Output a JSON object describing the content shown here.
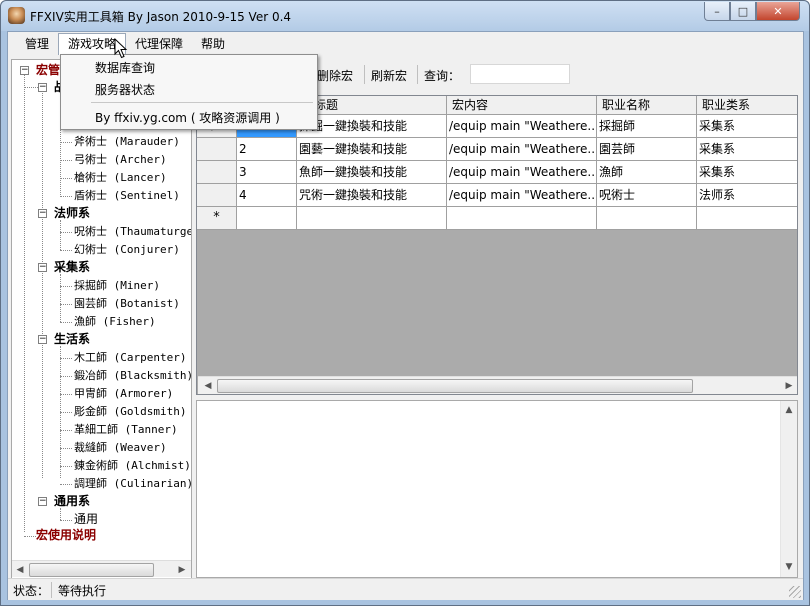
{
  "window": {
    "title": "FFXIV实用工具箱 By Jason 2010-9-15 Ver 0.4",
    "caption": {
      "minimize": "–",
      "maximize": "□",
      "close": "✕"
    }
  },
  "menubar": {
    "items": [
      {
        "label": "管理"
      },
      {
        "label": "游戏攻略"
      },
      {
        "label": "代理保障"
      },
      {
        "label": "帮助"
      }
    ],
    "open_menu": {
      "items": [
        "数据库查询",
        "服务器状态",
        "By ffxiv.yg.com ( 攻略资源调用 )"
      ]
    }
  },
  "tree": {
    "root_label": "宏管理",
    "visible": [
      {
        "label": "战",
        "kind": "category"
      },
      {
        "label": "斧術士 (Marauder)",
        "kind": "leaf"
      },
      {
        "label": "弓術士 (Archer)",
        "kind": "leaf"
      },
      {
        "label": "槍術士 (Lancer)",
        "kind": "leaf"
      },
      {
        "label": "盾術士 (Sentinel)",
        "kind": "leaf"
      },
      {
        "label": "法师系",
        "kind": "category"
      },
      {
        "label": "呪術士 (Thaumaturge)",
        "kind": "leaf"
      },
      {
        "label": "幻術士 (Conjurer)",
        "kind": "leaf"
      },
      {
        "label": "采集系",
        "kind": "category"
      },
      {
        "label": "採掘師 (Miner)",
        "kind": "leaf"
      },
      {
        "label": "園芸師 (Botanist)",
        "kind": "leaf"
      },
      {
        "label": "漁師 (Fisher)",
        "kind": "leaf"
      },
      {
        "label": "生活系",
        "kind": "category"
      },
      {
        "label": "木工師 (Carpenter)",
        "kind": "leaf"
      },
      {
        "label": "鍛冶師 (Blacksmith)",
        "kind": "leaf"
      },
      {
        "label": "甲冑師 (Armorer)",
        "kind": "leaf"
      },
      {
        "label": "彫金師 (Goldsmith)",
        "kind": "leaf"
      },
      {
        "label": "革細工師 (Tanner)",
        "kind": "leaf"
      },
      {
        "label": "裁縫師 (Weaver)",
        "kind": "leaf"
      },
      {
        "label": "錬金術師 (Alchmist)",
        "kind": "leaf"
      },
      {
        "label": "調理師 (Culinarian)",
        "kind": "leaf"
      },
      {
        "label": "通用系",
        "kind": "category"
      },
      {
        "label": "通用",
        "kind": "leaf"
      }
    ],
    "footer_label": "宏使用说明",
    "expander_minus": "−"
  },
  "toolbar": {
    "delete_macro": "删除宏",
    "refresh_macro": "刷新宏",
    "search_label": "查询：",
    "search_value": ""
  },
  "grid": {
    "columns": [
      "宏标题",
      "宏内容",
      "职业名称",
      "职业类系"
    ],
    "rows": [
      {
        "index": "1",
        "title": "採掘一鍵換裝和技能",
        "content": "/equip main \"Weathere...",
        "job": "採掘師",
        "class": "采集系",
        "selected_title": true
      },
      {
        "index": "2",
        "title": "園藝一鍵換裝和技能",
        "content": "/equip main \"Weathere...",
        "job": "園芸師",
        "class": "采集系"
      },
      {
        "index": "3",
        "title": "魚師一鍵換裝和技能",
        "content": "/equip main \"Weathere...",
        "job": "漁師",
        "class": "采集系"
      },
      {
        "index": "4",
        "title": "咒術一鍵換裝和技能",
        "content": "/equip main \"Weathere...",
        "job": "呪術士",
        "class": "法师系"
      }
    ],
    "new_row_marker": "*",
    "current_row_marker": "▶"
  },
  "status": {
    "label": "状态：",
    "value": "等待执行"
  },
  "colors": {
    "tree_red": "#8b0000",
    "selection": "#3399ff",
    "grid_background": "#ababab"
  }
}
